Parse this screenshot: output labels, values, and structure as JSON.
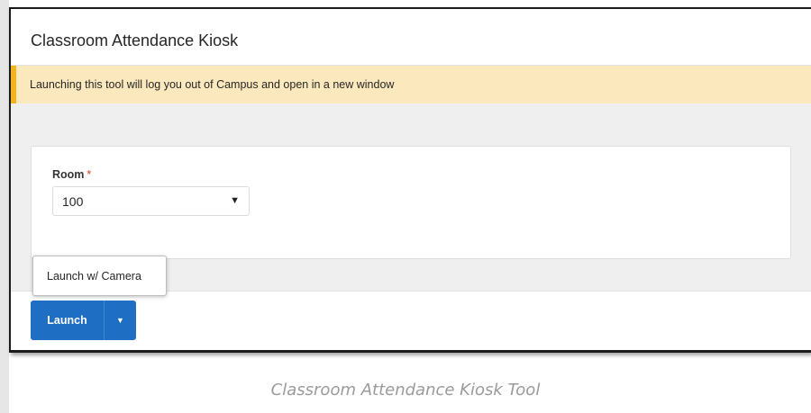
{
  "header": {
    "title": "Classroom Attendance Kiosk"
  },
  "notice": {
    "text": "Launching this tool will log you out of Campus and open in a new window"
  },
  "form": {
    "room_label": "Room",
    "required_marker": "*",
    "room_value": "100",
    "select_caret": "▼"
  },
  "footer": {
    "launch_label": "Launch",
    "toggle_caret": "▼",
    "dropdown_items": [
      "Launch w/ Camera"
    ]
  },
  "caption": "Classroom Attendance Kiosk Tool",
  "colors": {
    "primary_button": "#1e6fc4",
    "notice_background": "#fce8bd",
    "notice_accent": "#f2b320",
    "required": "#d33b2c"
  }
}
